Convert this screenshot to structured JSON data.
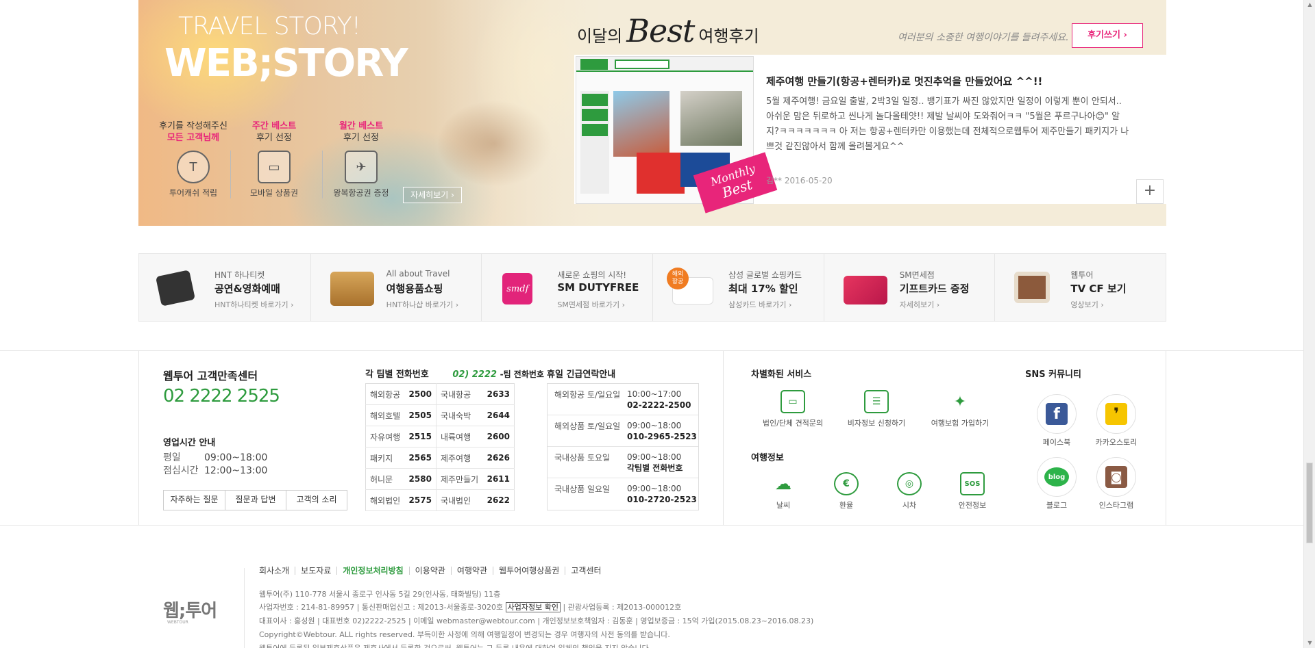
{
  "hero": {
    "travel_story": "TRAVEL STORY!",
    "web_story": "WEB;STORY",
    "benefits": [
      {
        "line1": "후기를 작성해주신",
        "line2": "모든 고객님께",
        "icon": "coin-icon",
        "label": "투어캐쉬 적립"
      },
      {
        "line1": "주간 베스트",
        "line2": "후기 선정",
        "icon": "card-icon",
        "label": "모바일 상품권"
      },
      {
        "line1": "월간 베스트",
        "line2": "후기 선정",
        "icon": "ticket-icon",
        "label": "왕복항공권 증정"
      }
    ],
    "detail_btn": "자세히보기 ›",
    "best_prefix": "이달의",
    "best_word": "Best",
    "best_suffix": "여행후기",
    "best_sub": "여러분의 소중한 여행이야기를 들려주세요.",
    "write_btn": "후기쓰기 ›",
    "review": {
      "title": "제주여행 만들기(항공+렌터카)로 멋진추억을 만들었어요 ^^!!",
      "body": "5월 제주여행! 금요일 출발, 2박3일 일정.. 뱅기표가 싸진 않았지만 일정이 이렇게 뿐이 안되서.. 아쉬운 맘은 뒤로하고 씬나게 놀다올테얏!! 제발 날씨야 도와줘어ㅋㅋ \"5월은 푸르구나아😊\" 알지?ㅋㅋㅋㅋㅋㅋㅋ 아 저는 항공+렌터카만 이용했는데 전체적으로웹투어 제주만들기 패키지가 나쁘것 같진않아서 함께 올려볼게요^^",
      "meta": "김** 2016-05-20",
      "badge_line1": "Monthly",
      "badge_line2": "Best",
      "plus": "+"
    }
  },
  "shortcuts": [
    {
      "t1": "HNT 하나티켓",
      "t2": "공연&영화예매",
      "t3": "HNT하나티켓 바로가기 ›",
      "icon": "clapperboard-icon",
      "color": "#333333"
    },
    {
      "t1": "All about Travel",
      "t2": "여행용품쇼핑",
      "t3": "HNT하나샵 바로가기 ›",
      "icon": "luggage-icon",
      "color": "#c9903f"
    },
    {
      "t1": "새로운 쇼핑의 시작!",
      "t2": "SM DUTYFREE",
      "t3": "SM면세점 바로가기 ›",
      "icon": "smdf-icon",
      "color": "#e2247a"
    },
    {
      "t1": "삼성 글로벌 쇼핑카드",
      "t2": "최대 17% 할인",
      "t3": "삼성카드 바로가기 ›",
      "icon": "creditcard-icon",
      "color": "#f07c22"
    },
    {
      "t1": "SM면세점",
      "t2": "기프트카드 증정",
      "t3": "자세히보기 ›",
      "icon": "giftcard-icon",
      "color": "#d7245b"
    },
    {
      "t1": "웹투어",
      "t2": "TV CF 보기",
      "t3": "영상보기 ›",
      "icon": "tv-icon",
      "color": "#8c5a3c"
    }
  ],
  "cs": {
    "title": "웹투어 고객만족센터",
    "phone": "02 2222 2525",
    "hours_title": "영업시간 안내",
    "hours": [
      {
        "k": "평일",
        "v": "09:00~18:00"
      },
      {
        "k": "점심시간",
        "v": "12:00~13:00"
      }
    ],
    "buttons": [
      "자주하는 질문",
      "질문과 답변",
      "고객의 소리"
    ]
  },
  "team_phone": {
    "title": "각 팀별 전화번호",
    "prefix": "02) 2222",
    "suffix": "-팀 전화번호",
    "rows": [
      [
        "해외항공",
        "2500",
        "국내항공",
        "2633"
      ],
      [
        "해외호텔",
        "2505",
        "국내숙박",
        "2644"
      ],
      [
        "자유여행",
        "2515",
        "내륙여행",
        "2600"
      ],
      [
        "패키지",
        "2565",
        "제주여행",
        "2626"
      ],
      [
        "허니문",
        "2580",
        "제주만들기",
        "2611"
      ],
      [
        "해외법인",
        "2575",
        "국내법인",
        "2622"
      ]
    ]
  },
  "holiday": {
    "title": "휴일 긴급연락안내",
    "rows": [
      {
        "a": "해외항공 토/일요일",
        "time": "10:00~17:00",
        "phone": "02-2222-2500"
      },
      {
        "a": "해외상품 토/일요일",
        "time": "09:00~18:00",
        "phone": "010-2965-2523"
      },
      {
        "a": "국내상품 토요일",
        "time": "09:00~18:00",
        "phone": "각팀별 전화번호"
      },
      {
        "a": "국내상품 일요일",
        "time": "09:00~18:00",
        "phone": "010-2720-2523"
      }
    ]
  },
  "services": {
    "title": "차별화된 서비스",
    "items": [
      {
        "label": "법인/단체 견적문의",
        "icon": "briefcase-icon",
        "glyph": "▭"
      },
      {
        "label": "비자정보 신청하기",
        "icon": "clipboard-icon",
        "glyph": "☰"
      },
      {
        "label": "여행보험 가입하기",
        "icon": "walker-icon",
        "glyph": "✦"
      }
    ],
    "info_title": "여행정보",
    "info": [
      {
        "label": "날씨",
        "icon": "cloud-rain-icon",
        "glyph": "☁"
      },
      {
        "label": "환율",
        "icon": "exchange-icon",
        "glyph": "€"
      },
      {
        "label": "시차",
        "icon": "globe-icon",
        "glyph": "◎"
      },
      {
        "label": "안전정보",
        "icon": "sos-icon",
        "glyph": "SOS"
      }
    ]
  },
  "sns": {
    "title": "SNS 커뮤니티",
    "items": [
      {
        "label": "페이스북",
        "icon": "facebook-icon",
        "glyph": "f",
        "color": "#3b5998"
      },
      {
        "label": "카카오스토리",
        "icon": "kakaostory-icon",
        "glyph": "❜",
        "color": "#f6c500"
      },
      {
        "label": "블로그",
        "icon": "blog-icon",
        "glyph": "blog",
        "color": "#2db34a"
      },
      {
        "label": "인스타그램",
        "icon": "instagram-icon",
        "glyph": "◙",
        "color": "#8a5a44"
      }
    ]
  },
  "legal": {
    "logo": "웹;투어",
    "logo_sub": "WEBTOUR",
    "links": [
      "회사소개",
      "보도자료",
      "개인정보처리방침",
      "이용약관",
      "여행약관",
      "웹투어여행상품권",
      "고객센터"
    ],
    "line1": "웹투어(주) 110-778 서울시 종로구 인사동 5길 29(인사동, 태화빌딩) 11층",
    "line2a": "사업자번호 : 214-81-89957  |  통신판매업신고 : 제2013-서울종로-3020호",
    "line2b": "사업자정보 확인",
    "line2c": "|  관광사업등록 : 제2013-000012호",
    "line3": "대표이사 : 홍성원  |  대표번호 02)2222-2525  |  이메일 webmaster@webtour.com  |  개인정보보호책임자 : 김동훈  |  영업보증금 : 15억 가입(2015.08.23~2016.08.23)",
    "line4": "Copyright©Webtour. ALL rights reserved. 부득이한 사정에 의해 여행일정이 변경되는 경우 여행자의 사전 동의를 받습니다.",
    "line5": "웹투어에 등록된 일부제휴상품은 제휴사에서 등록한 것으로써, 웹투어는 그 등록 내용에 대하여 일체의 책임을 지지 않습니다."
  }
}
